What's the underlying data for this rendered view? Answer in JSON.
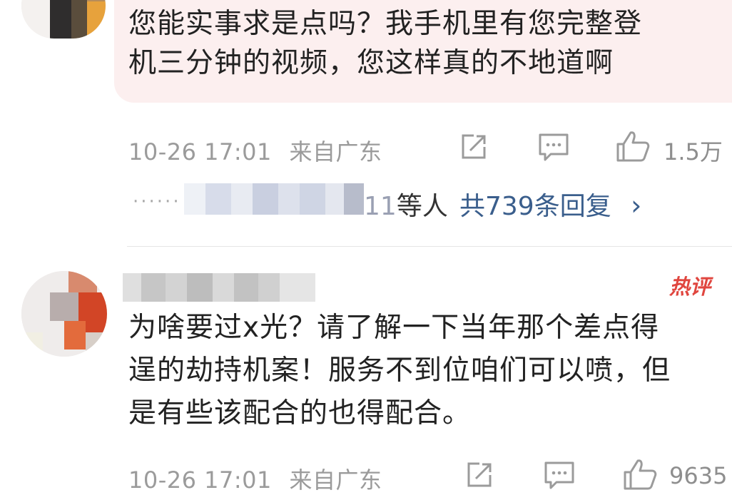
{
  "comment1": {
    "text_line1": "您能实事求是点吗？我手机里有您完整登",
    "text_line2": "机三分钟的视频，您这样真的不地道啊",
    "timestamp": "10-26 17:01",
    "location": "来自广东",
    "like_count": "1.5万",
    "replies": {
      "dots": "······",
      "blurred_tail": "11",
      "suffix": "等人",
      "link": "共739条回复",
      "chevron": "›"
    }
  },
  "comment2": {
    "badge": "热评",
    "text_line1": "为啥要过x光？请了解一下当年那个差点得",
    "text_line2": "逞的劫持机案！服务不到位咱们可以喷，但",
    "text_line3": "是有些该配合的也得配合。",
    "timestamp": "10-26 17:01",
    "location": "来自广东",
    "like_count": "9635"
  },
  "icons": [
    "share-icon",
    "comment-icon",
    "like-icon"
  ],
  "colors": {
    "highlight_bubble": "#fcefef",
    "link": "#3a5e8c",
    "hot_badge": "#e0463f",
    "meta_text": "#9b9b9b"
  }
}
